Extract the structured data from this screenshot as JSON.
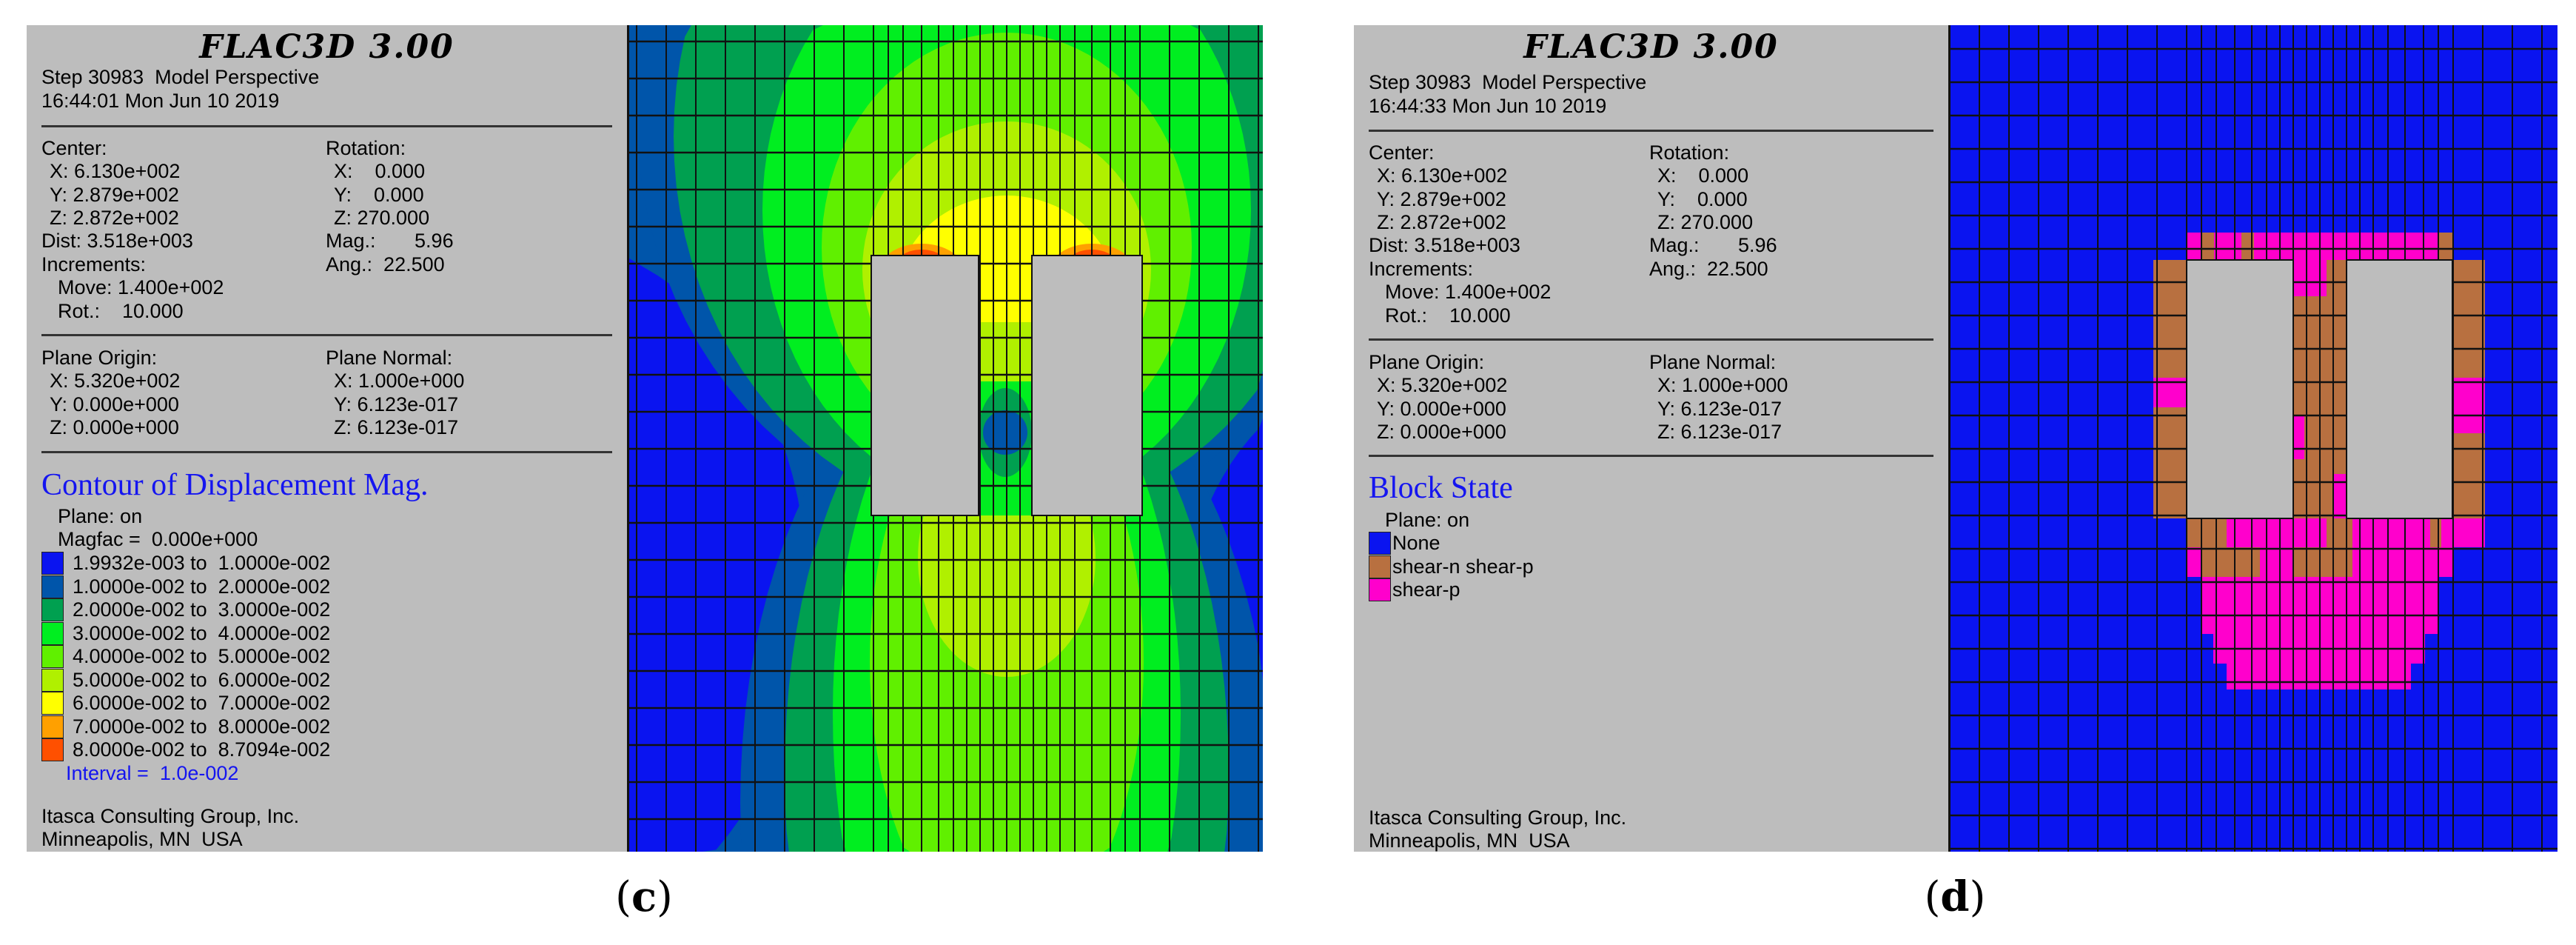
{
  "figures": [
    {
      "caption_letter": "c",
      "title": "FLAC3D 3.00",
      "step_line": "Step 30983  Model Perspective",
      "time_line": "16:44:01 Mon Jun 10 2019",
      "center": {
        "label": "Center:",
        "x": "X: 6.130e+002",
        "y": "Y: 2.879e+002",
        "z": "Z: 2.872e+002"
      },
      "rotation": {
        "label": "Rotation:",
        "x": "X:    0.000",
        "y": "Y:    0.000",
        "z": "Z: 270.000"
      },
      "dist": "Dist: 3.518e+003",
      "mag": "Mag.:       5.96",
      "increments": "Increments:",
      "ang": "Ang.:  22.500",
      "move": "Move: 1.400e+002",
      "rot": "Rot.:    10.000",
      "plane_origin": {
        "label": "Plane Origin:",
        "x": "X: 5.320e+002",
        "y": "Y: 0.000e+000",
        "z": "Z: 0.000e+000"
      },
      "plane_normal": {
        "label": "Plane Normal:",
        "x": "X: 1.000e+000",
        "y": "Y: 6.123e-017",
        "z": "Z: 6.123e-017"
      },
      "legend_title": "Contour of Displacement Mag.",
      "plane_on": "Plane: on",
      "magfac": "Magfac =  0.000e+000",
      "legend": [
        {
          "label": "1.9932e-003 to  1.0000e-002",
          "color": "#0a14f0"
        },
        {
          "label": "1.0000e-002 to  2.0000e-002",
          "color": "#0055aa"
        },
        {
          "label": "2.0000e-002 to  3.0000e-002",
          "color": "#00a050"
        },
        {
          "label": "3.0000e-002 to  4.0000e-002",
          "color": "#00ee20"
        },
        {
          "label": "4.0000e-002 to  5.0000e-002",
          "color": "#60f000"
        },
        {
          "label": "5.0000e-002 to  6.0000e-002",
          "color": "#b0f000"
        },
        {
          "label": "6.0000e-002 to  7.0000e-002",
          "color": "#ffff00"
        },
        {
          "label": "7.0000e-002 to  8.0000e-002",
          "color": "#ffa000"
        },
        {
          "label": "8.0000e-002 to  8.7094e-002",
          "color": "#ff5000"
        }
      ],
      "interval": "Interval =  1.0e-002",
      "company": "Itasca Consulting Group, Inc.",
      "location": "Minneapolis, MN  USA"
    },
    {
      "caption_letter": "d",
      "title": "FLAC3D 3.00",
      "step_line": "Step 30983  Model Perspective",
      "time_line": "16:44:33 Mon Jun 10 2019",
      "center": {
        "label": "Center:",
        "x": "X: 6.130e+002",
        "y": "Y: 2.879e+002",
        "z": "Z: 2.872e+002"
      },
      "rotation": {
        "label": "Rotation:",
        "x": "X:    0.000",
        "y": "Y:    0.000",
        "z": "Z: 270.000"
      },
      "dist": "Dist: 3.518e+003",
      "mag": "Mag.:       5.96",
      "increments": "Increments:",
      "ang": "Ang.:  22.500",
      "move": "Move: 1.400e+002",
      "rot": "Rot.:    10.000",
      "plane_origin": {
        "label": "Plane Origin:",
        "x": "X: 5.320e+002",
        "y": "Y: 0.000e+000",
        "z": "Z: 0.000e+000"
      },
      "plane_normal": {
        "label": "Plane Normal:",
        "x": "X: 1.000e+000",
        "y": "Y: 6.123e-017",
        "z": "Z: 6.123e-017"
      },
      "legend_title": "Block State",
      "plane_on": "Plane: on",
      "legend": [
        {
          "label": "None",
          "color": "#0a14f0"
        },
        {
          "label": "shear-n shear-p",
          "color": "#b87040"
        },
        {
          "label": "shear-p",
          "color": "#ff00cc"
        }
      ],
      "company": "Itasca Consulting Group, Inc.",
      "location": "Minneapolis, MN  USA"
    }
  ],
  "colors": {
    "hole": "#bdbdbd",
    "grid": "#111111"
  }
}
